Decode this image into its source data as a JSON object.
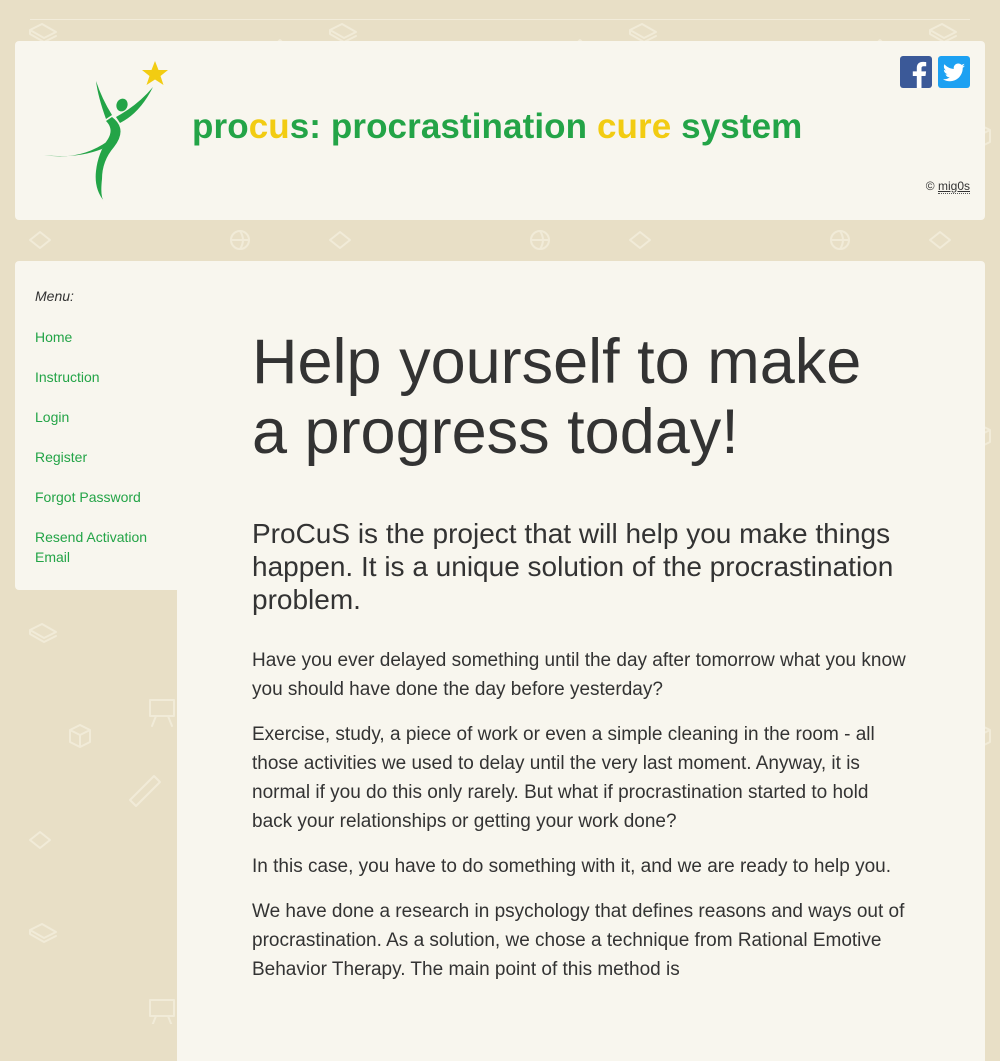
{
  "header": {
    "title_part1": "pro",
    "title_part2": "cu",
    "title_part3": "s: procrastination ",
    "title_part4": "cure",
    "title_part5": " system",
    "copyright_symbol": "©",
    "copyright_author": "mig0s",
    "social": [
      {
        "name": "facebook",
        "icon": "facebook-icon",
        "color": "#3b5998"
      },
      {
        "name": "twitter",
        "icon": "twitter-icon",
        "color": "#1da1f2"
      }
    ]
  },
  "sidebar": {
    "title": "Menu:",
    "items": [
      {
        "label": "Home"
      },
      {
        "label": "Instruction"
      },
      {
        "label": "Login"
      },
      {
        "label": "Register"
      },
      {
        "label": "Forgot Password"
      },
      {
        "label": "Resend Activation Email"
      }
    ]
  },
  "main": {
    "headline": "Help yourself to make a progress today!",
    "lead": "ProCuS is the project that will help you make things happen. It is a unique solution of the procrastination problem.",
    "paragraphs": [
      "Have you ever delayed something until the day after tomorrow what you know you should have done the day before yesterday?",
      "Exercise, study, a piece of work or even a simple cleaning in the room - all those activities we used to delay until the very last moment. Anyway, it is normal if you do this only rarely. But what if procrastination started to hold back your relationships or getting your work done?",
      "In this case, you have to do something with it, and we are ready to help you.",
      "We have done a research in psychology that defines reasons and ways out of procrastination. As a solution, we chose a technique from Rational Emotive Behavior Therapy. The main point of this method is"
    ]
  },
  "colors": {
    "background": "#e8dfc6",
    "panel": "#f8f6ee",
    "brand_green": "#23a447",
    "brand_yellow": "#f2cc12",
    "text": "#333333"
  }
}
